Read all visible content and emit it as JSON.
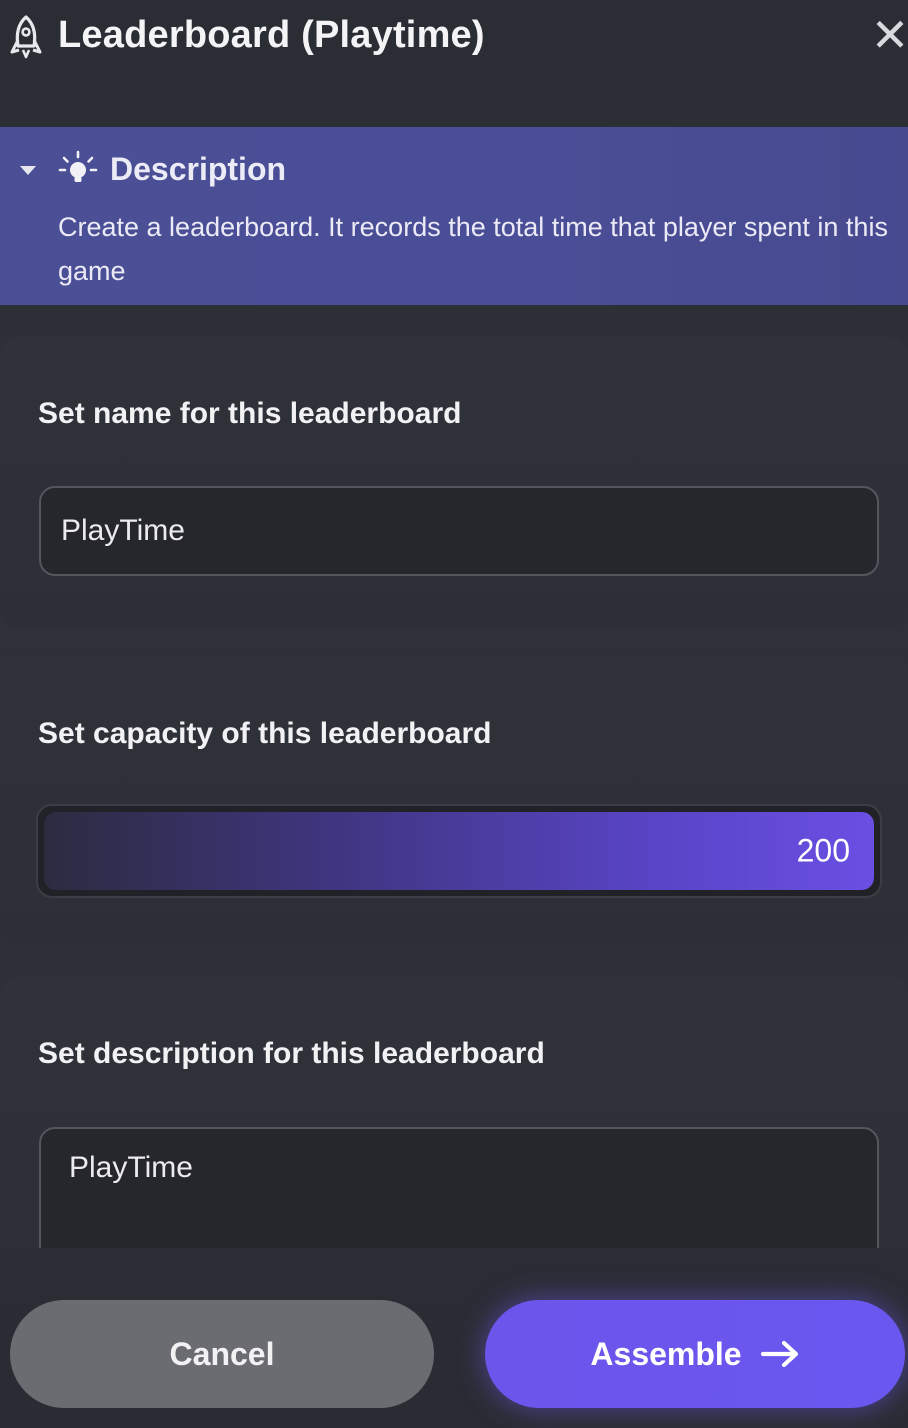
{
  "header": {
    "title": "Leaderboard (Playtime)",
    "close_symbol": "✕"
  },
  "description": {
    "title": "Description",
    "text": "Create a leaderboard. It records the total time that player spent in this game"
  },
  "fields": {
    "name": {
      "label": "Set name for this leaderboard",
      "value": "PlayTime"
    },
    "capacity": {
      "label": "Set capacity of this leaderboard",
      "value": "200",
      "fill_fraction": 1.0
    },
    "description": {
      "label": "Set description for this leaderboard",
      "value": "PlayTime"
    }
  },
  "footer": {
    "cancel_label": "Cancel",
    "assemble_label": "Assemble"
  },
  "colors": {
    "accent": "#6a57f0",
    "description_bg": "#4b4f95",
    "cancel_bg": "#6b6c72",
    "panel_bg": "#2c2e36"
  },
  "icons": {
    "header": "rocket-icon",
    "close": "close-icon",
    "caret": "caret-down-icon",
    "description": "lightbulb-icon",
    "assemble": "arrow-right-icon"
  }
}
